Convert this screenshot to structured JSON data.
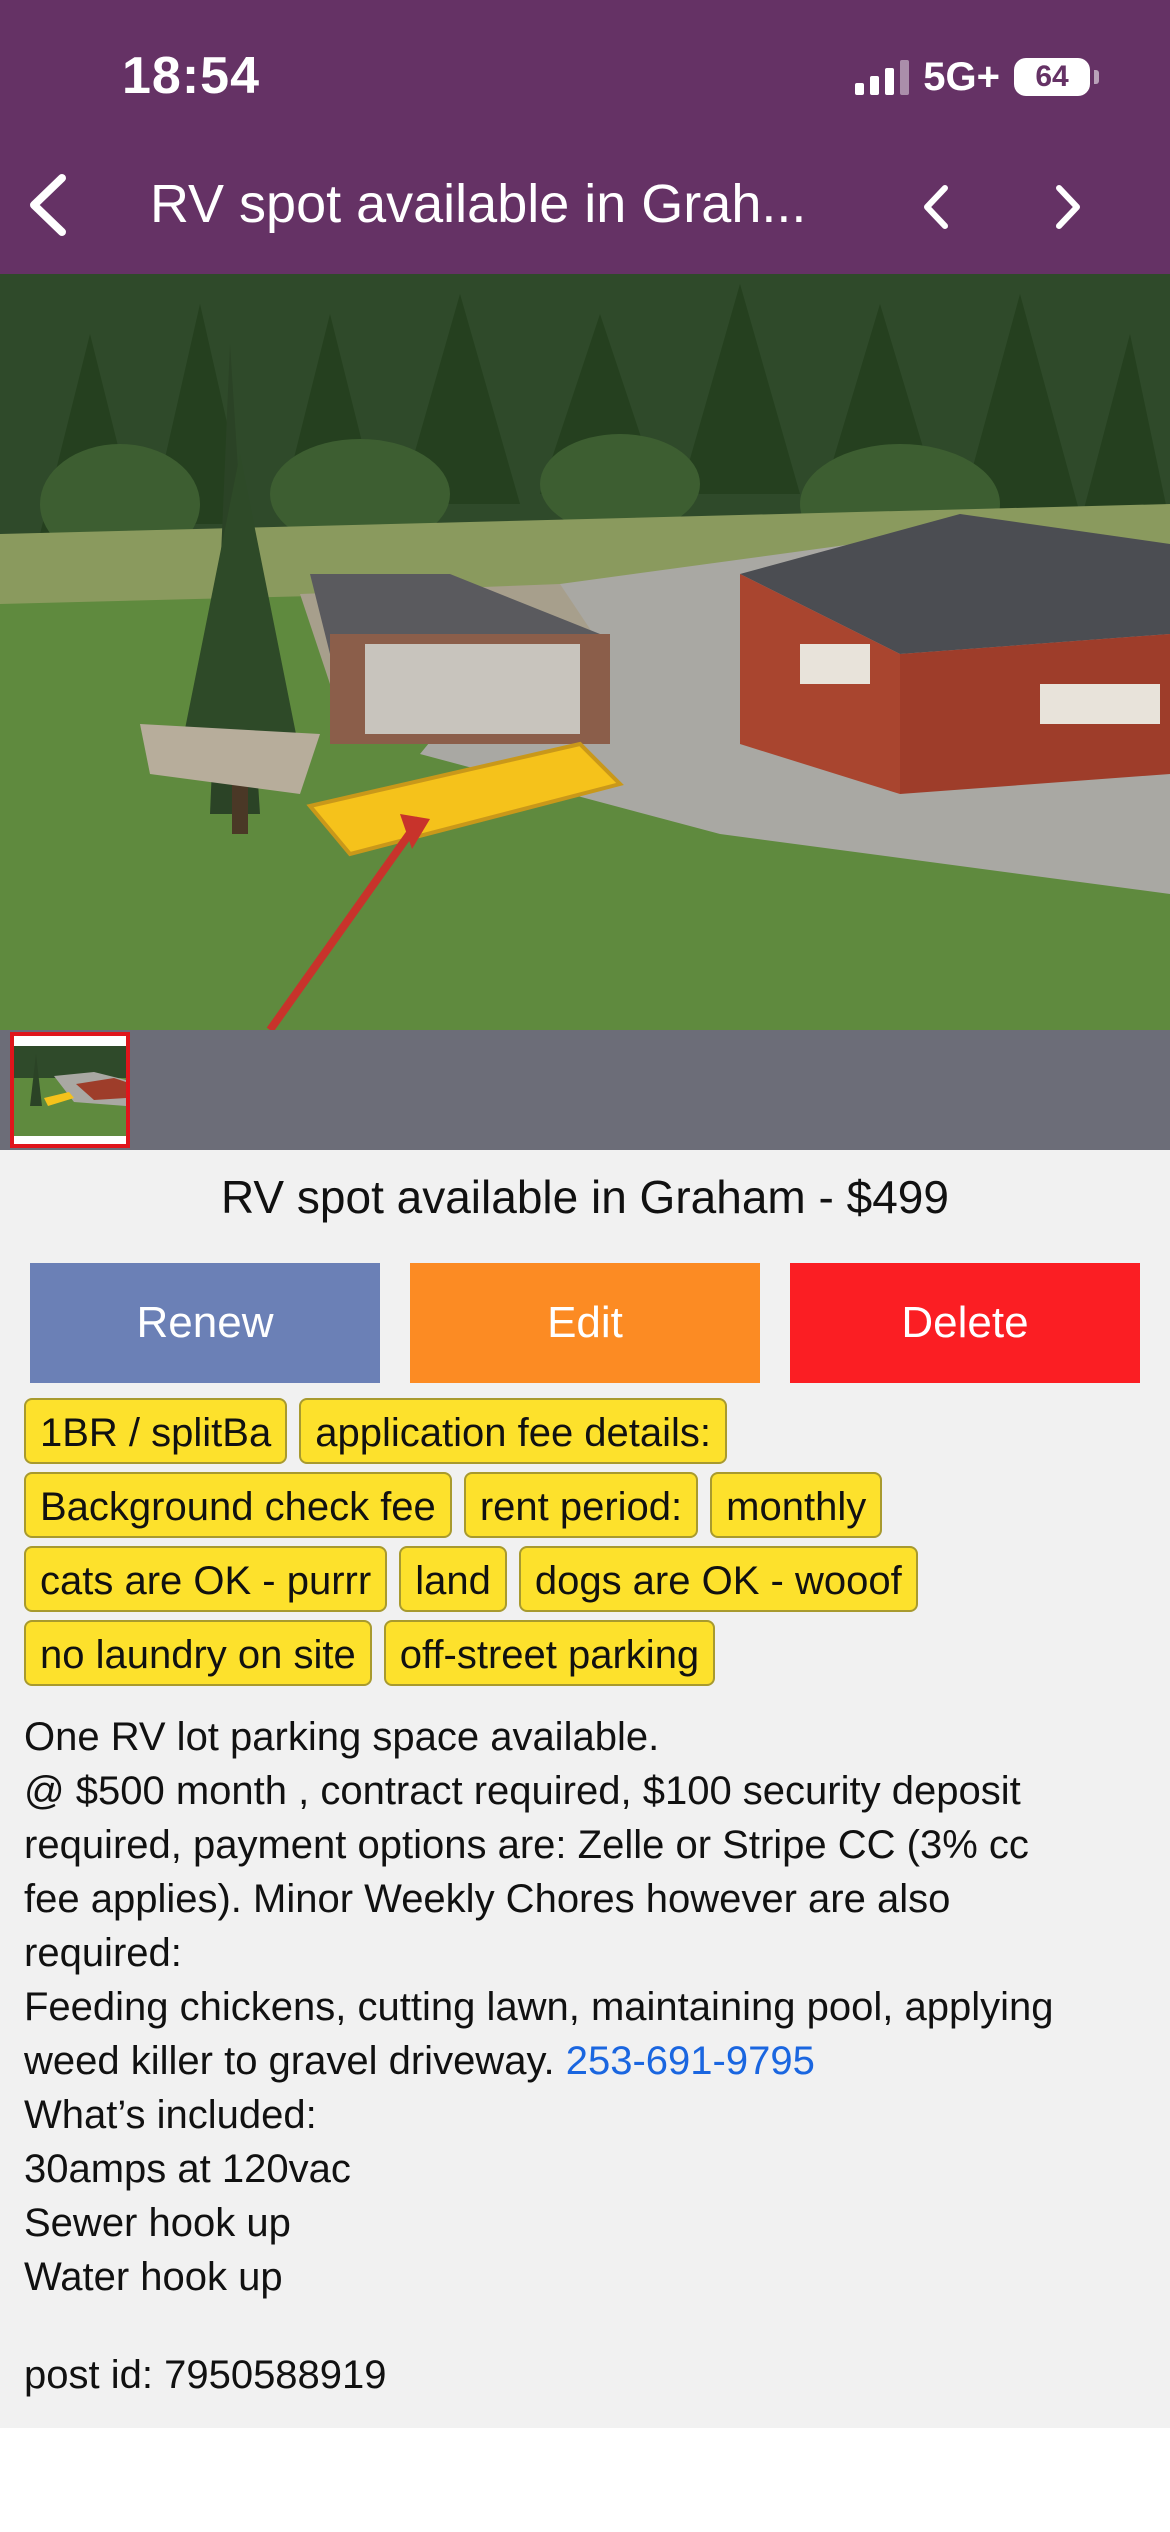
{
  "status_bar": {
    "time": "18:54",
    "network": "5G+",
    "battery": "64"
  },
  "nav": {
    "title": "RV spot available in Grah..."
  },
  "listing": {
    "title": "RV spot available in Graham - $499",
    "buttons": {
      "renew": "Renew",
      "edit": "Edit",
      "delete": "Delete"
    },
    "tags": [
      "1BR / splitBa",
      "application fee details:",
      "Background check fee",
      "rent period:",
      "monthly",
      "cats are OK - purrr",
      "land",
      "dogs are OK - wooof",
      "no laundry on site",
      "off-street parking"
    ],
    "description": {
      "l1": "One RV lot parking space available.",
      "l2": "@ $500 month , contract required, $100 security deposit",
      "l3": "required, payment options are: Zelle or Stripe CC (3% cc",
      "l4": "fee applies). Minor Weekly Chores however are also",
      "l5": "required:",
      "l6": "Feeding chickens, cutting lawn, maintaining pool, applying",
      "l7": "weed killer to gravel driveway.",
      "phone": "253-691-9795",
      "l8": "What’s included:",
      "l9": "30amps at 120vac",
      "l10": "Sewer hook up",
      "l11": "Water hook up"
    },
    "post_id": "post id: 7950588919"
  },
  "colors": {
    "header": "#653265",
    "renew": "#6b80b6",
    "edit": "#fc8b23",
    "delete": "#fb1e23",
    "tag": "#fde12c",
    "link": "#1a66e0",
    "thumb_strip": "#6c6d78",
    "content_bg": "#f1f1f1"
  },
  "icons": {
    "back": "chevron-left-icon",
    "prev": "chevron-left-icon",
    "next": "chevron-right-icon"
  }
}
